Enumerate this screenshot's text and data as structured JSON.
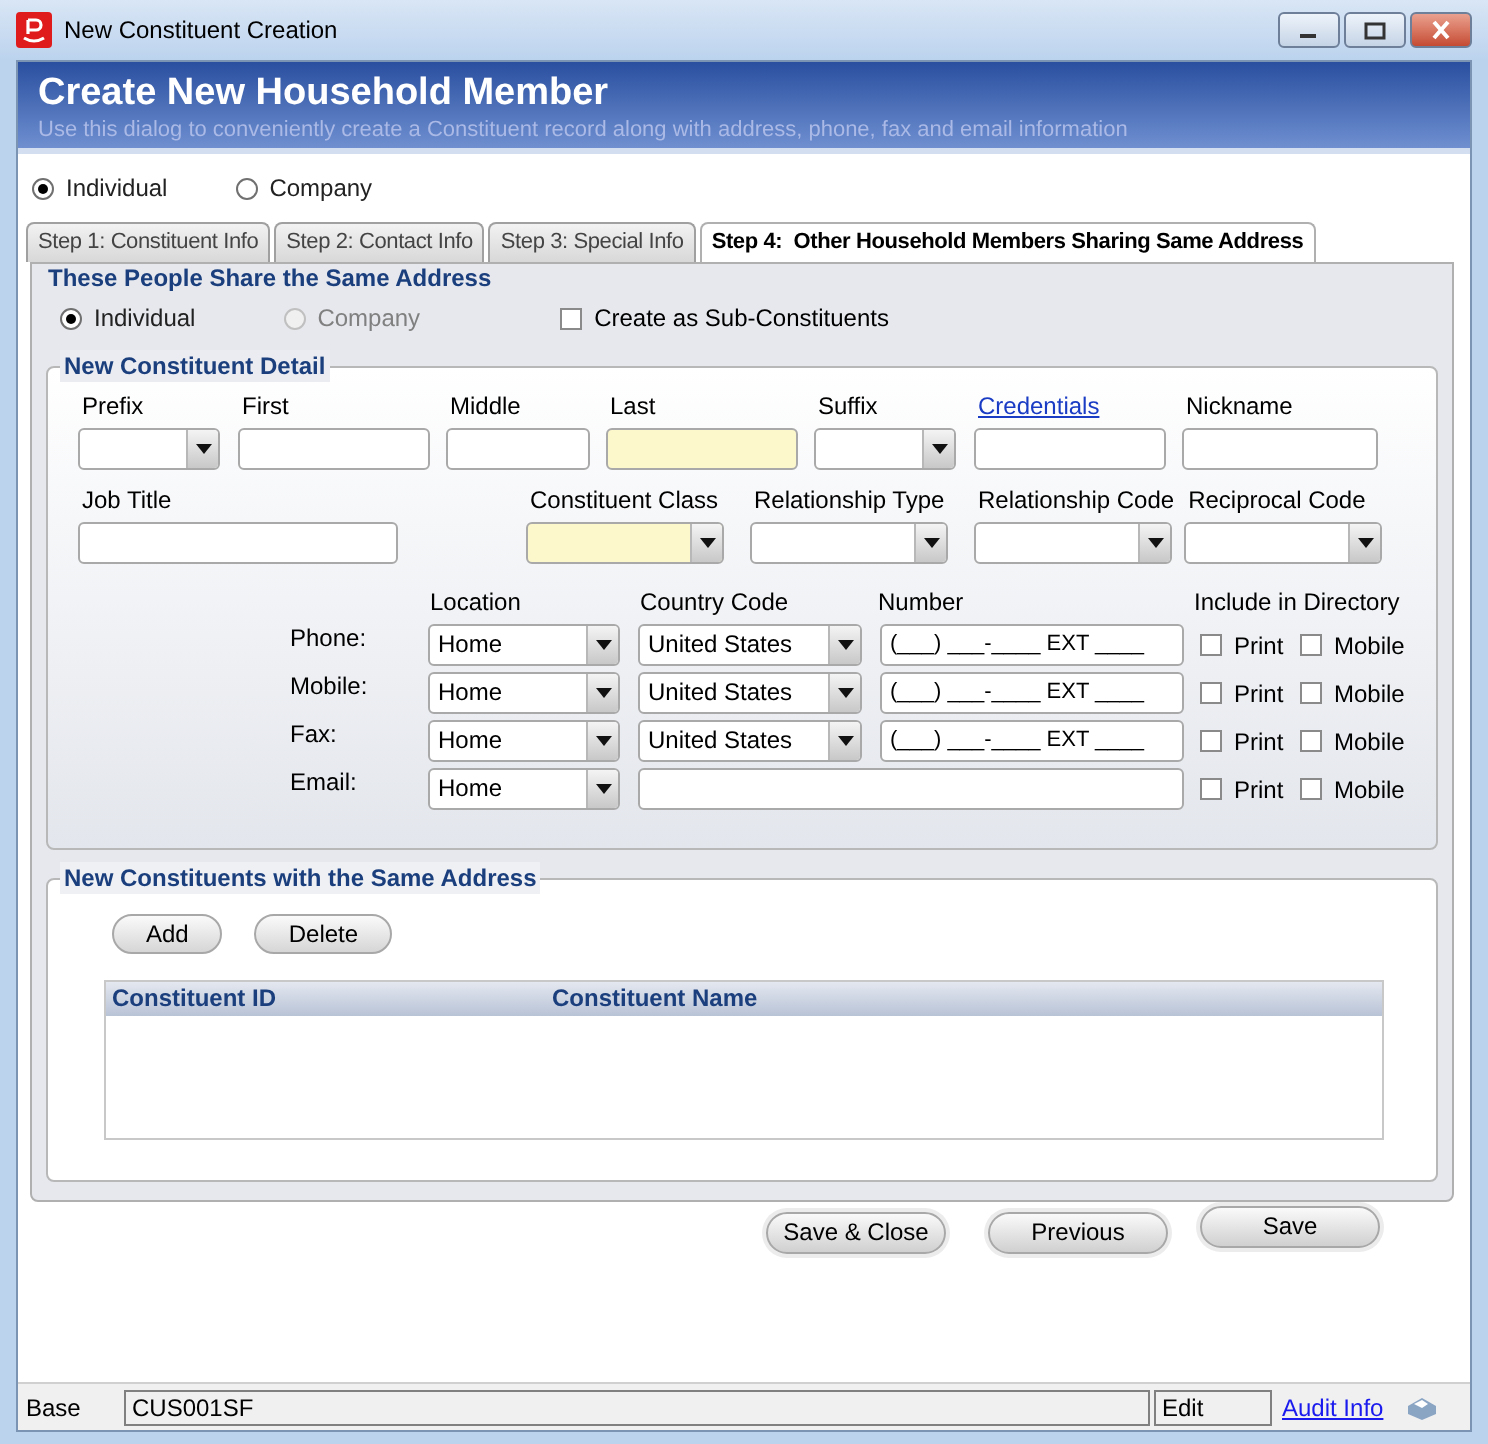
{
  "window": {
    "title": "New Constituent Creation"
  },
  "header": {
    "title": "Create New Household Member",
    "subtitle": "Use this dialog to conveniently create a Constituent record along with address, phone, fax and email information"
  },
  "type_options": [
    {
      "label": "Individual",
      "selected": true
    },
    {
      "label": "Company",
      "selected": false
    }
  ],
  "tabs": [
    {
      "label": "Step 1: Constituent Info",
      "selected": false
    },
    {
      "label": "Step 2: Contact Info",
      "selected": false
    },
    {
      "label": "Step 3: Special Info",
      "selected": false
    },
    {
      "label": "Step 4:  Other Household Members Sharing Same Address",
      "selected": true
    }
  ],
  "share_section": {
    "title": "These People Share the Same Address",
    "type_options": [
      {
        "label": "Individual",
        "selected": true,
        "disabled": false
      },
      {
        "label": "Company",
        "selected": false,
        "disabled": true
      }
    ],
    "sub_constituents": {
      "label": "Create as Sub-Constituents",
      "checked": false
    }
  },
  "detail": {
    "title": "New Constituent Detail",
    "fields": [
      {
        "label": "Prefix",
        "kind": "dropdown",
        "required": false
      },
      {
        "label": "First",
        "kind": "text",
        "required": false
      },
      {
        "label": "Middle",
        "kind": "text",
        "required": false
      },
      {
        "label": "Last",
        "kind": "text",
        "required": true
      },
      {
        "label": "Suffix",
        "kind": "dropdown",
        "required": false
      },
      {
        "label": "Credentials",
        "kind": "link",
        "required": false
      },
      {
        "label": "Nickname",
        "kind": "text",
        "required": false
      }
    ],
    "fields_2": [
      {
        "label": "Job Title",
        "kind": "text",
        "required": false
      },
      {
        "label": "Constituent Class",
        "kind": "dropdown",
        "required": true
      },
      {
        "label": "Relationship Type",
        "kind": "dropdown",
        "required": false
      },
      {
        "label": "Relationship Code",
        "kind": "dropdown",
        "required": false
      },
      {
        "label": "Reciprocal Code",
        "kind": "dropdown",
        "required": false
      }
    ],
    "contact": {
      "columns": [
        "Location",
        "Country Code",
        "Number",
        "Include in Directory"
      ],
      "rows": [
        {
          "label": "Phone:",
          "kind": "phone",
          "location": "Home",
          "country": "United States",
          "number": "(___) ___-____ EXT ____",
          "print": {
            "label": "Print",
            "checked": false
          },
          "mobile": {
            "label": "Mobile",
            "checked": false
          }
        },
        {
          "label": "Mobile:",
          "kind": "phone",
          "location": "Home",
          "country": "United States",
          "number": "(___) ___-____ EXT ____",
          "print": {
            "label": "Print",
            "checked": false
          },
          "mobile": {
            "label": "Mobile",
            "checked": false
          }
        },
        {
          "label": "Fax:",
          "kind": "phone",
          "location": "Home",
          "country": "United States",
          "number": "(___) ___-____ EXT ____",
          "print": {
            "label": "Print",
            "checked": false
          },
          "mobile": {
            "label": "Mobile",
            "checked": false
          }
        },
        {
          "label": "Email:",
          "kind": "email",
          "location": "Home",
          "print": {
            "label": "Print",
            "checked": false
          },
          "mobile": {
            "label": "Mobile",
            "checked": false
          }
        }
      ]
    }
  },
  "household": {
    "title": "New Constituents with the Same Address",
    "buttons": [
      "Add",
      "Delete"
    ],
    "table": {
      "columns": [
        "Constituent ID",
        "Constituent Name"
      ]
    }
  },
  "buttons": [
    "Save & Close",
    "Previous",
    "Save"
  ],
  "status_bar": {
    "mode": "Base",
    "form_id": "CUS001SF",
    "state": "Edit",
    "link": "Audit Info"
  }
}
